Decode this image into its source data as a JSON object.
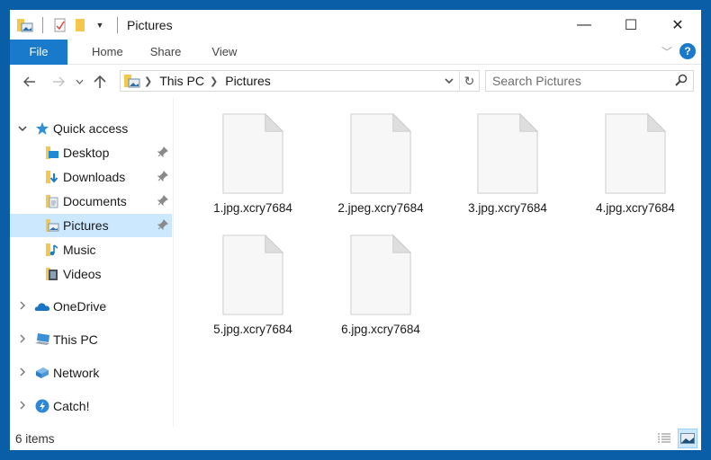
{
  "window": {
    "title": "Pictures",
    "controls": {
      "minimize": "—",
      "maximize": "☐",
      "close": "✕"
    }
  },
  "ribbon": {
    "tabs": [
      {
        "label": "File",
        "active": true
      },
      {
        "label": "Home"
      },
      {
        "label": "Share"
      },
      {
        "label": "View"
      }
    ],
    "help_label": "?",
    "accent": "#1979ca"
  },
  "address": {
    "breadcrumb": [
      "This PC",
      "Pictures"
    ],
    "search_placeholder": "Search Pictures"
  },
  "nav": {
    "quick_access": {
      "label": "Quick access"
    },
    "items": [
      {
        "label": "Desktop",
        "icon": "desktop-folder-icon",
        "pinned": true
      },
      {
        "label": "Downloads",
        "icon": "downloads-folder-icon",
        "pinned": true
      },
      {
        "label": "Documents",
        "icon": "documents-folder-icon",
        "pinned": true
      },
      {
        "label": "Pictures",
        "icon": "pictures-folder-icon",
        "pinned": true,
        "selected": true
      },
      {
        "label": "Music",
        "icon": "music-folder-icon",
        "pinned": false
      },
      {
        "label": "Videos",
        "icon": "videos-folder-icon",
        "pinned": false
      }
    ],
    "roots": [
      {
        "label": "OneDrive",
        "icon": "onedrive-icon"
      },
      {
        "label": "This PC",
        "icon": "this-pc-icon"
      },
      {
        "label": "Network",
        "icon": "network-icon"
      },
      {
        "label": "Catch!",
        "icon": "catch-icon"
      }
    ]
  },
  "files": [
    {
      "name": "1.jpg.xcry7684"
    },
    {
      "name": "2.jpeg.xcry7684"
    },
    {
      "name": "3.jpg.xcry7684"
    },
    {
      "name": "4.jpg.xcry7684"
    },
    {
      "name": "5.jpg.xcry7684"
    },
    {
      "name": "6.jpg.xcry7684"
    }
  ],
  "status": {
    "item_count": "6 items"
  }
}
